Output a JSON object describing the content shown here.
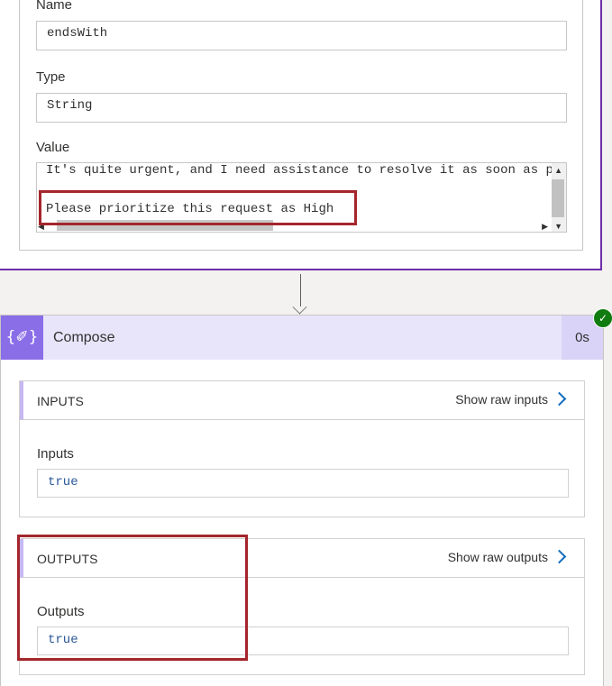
{
  "condition": {
    "name_label": "Name",
    "name_value": "endsWith",
    "type_label": "Type",
    "type_value": "String",
    "value_label": "Value",
    "value_line1": "It's quite urgent, and I need assistance to resolve it as soon as p",
    "value_line2": "Please prioritize this request as High"
  },
  "compose": {
    "icon": "{✐}",
    "title": "Compose",
    "duration": "0s",
    "status_icon": "check-icon",
    "status_color": "#107c10",
    "inputs": {
      "section_title": "INPUTS",
      "show_raw": "Show raw inputs",
      "label": "Inputs",
      "value": "true"
    },
    "outputs": {
      "section_title": "OUTPUTS",
      "show_raw": "Show raw outputs",
      "label": "Outputs",
      "value": "true"
    }
  },
  "colors": {
    "highlight_box": "#a4262c",
    "step_border": "#6e2da8",
    "compose_accent": "#8a6ee8"
  }
}
